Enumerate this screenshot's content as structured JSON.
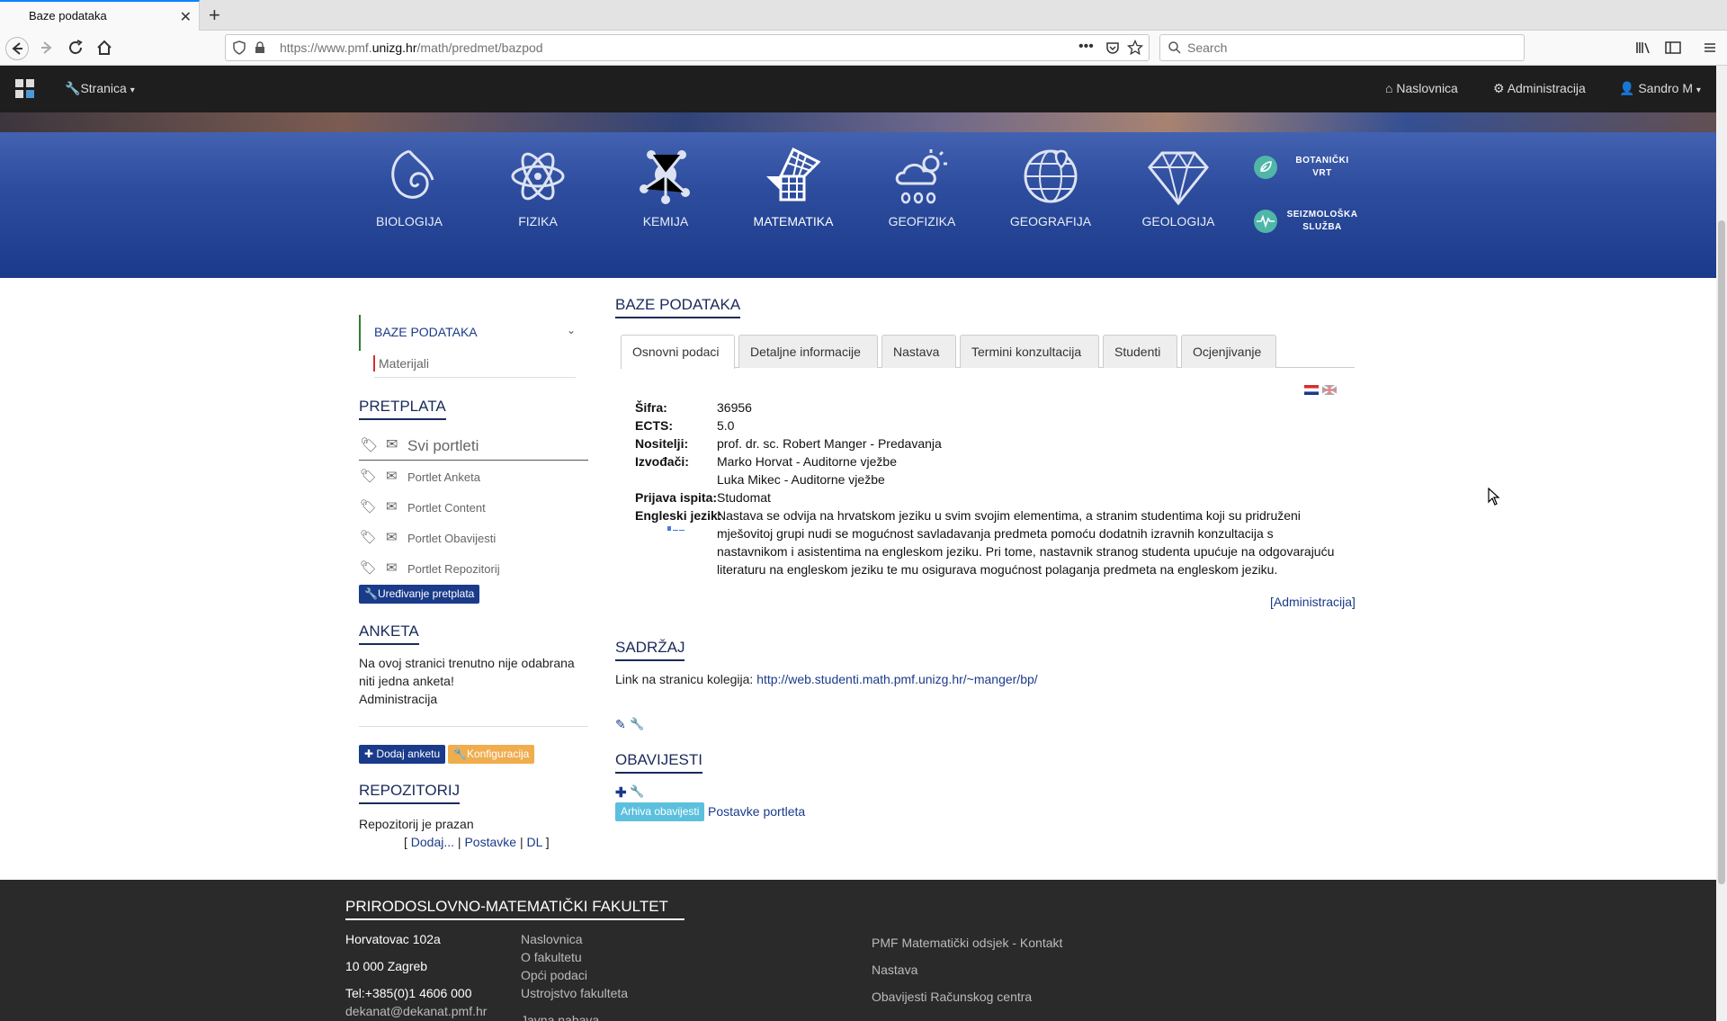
{
  "browser": {
    "tab_title": "Baze podataka",
    "url_prefix": "https://www.pmf.",
    "url_domain": "unizg.hr",
    "url_path": "/math/predmet/bazpod",
    "search_placeholder": "Search"
  },
  "sitebar": {
    "menu_label": "Stranica",
    "home": "Naslovnica",
    "admin": "Administracija",
    "user": "Sandro M"
  },
  "sciences": [
    {
      "label": "BIOLOGIJA"
    },
    {
      "label": "FIZIKA"
    },
    {
      "label": "KEMIJA"
    },
    {
      "label": "MATEMATIKA"
    },
    {
      "label": "GEOFIZIKA"
    },
    {
      "label": "GEOGRAFIJA"
    },
    {
      "label": "GEOLOGIJA"
    }
  ],
  "side_links": {
    "botanicki_1": "BOTANIČKI",
    "botanicki_2": "VRT",
    "seizmo_1": "SEIZMOLOŠKA",
    "seizmo_2": "SLUŽBA"
  },
  "left": {
    "nav_active": "BAZE PODATAKA",
    "nav_sub": "Materijali",
    "pretplata_title": "PRETPLATA",
    "svi_portleti": "Svi portleti",
    "portlets": [
      "Portlet Anketa",
      "Portlet Content",
      "Portlet Obavijesti",
      "Portlet Repozitorij"
    ],
    "uredivanje": "Uređivanje pretplata",
    "anketa_title": "ANKETA",
    "anketa_text_1": "Na ovoj stranici trenutno nije odabrana",
    "anketa_text_2": "niti jedna anketa!",
    "anketa_admin": "Administracija",
    "dodaj_anketu": "Dodaj anketu",
    "konfiguracija": "Konfiguracija",
    "repo_title": "REPOZITORIJ",
    "repo_empty": "Repozitorij je prazan",
    "repo_open": "[",
    "repo_dodaj": "Dodaj...",
    "repo_sep1": "|",
    "repo_postavke": "Postavke",
    "repo_sep2": "|",
    "repo_dl": "DL",
    "repo_close": "]"
  },
  "main": {
    "title": "BAZE PODATAKA",
    "tabs": [
      "Osnovni podaci",
      "Detaljne informacije",
      "Nastava",
      "Termini konzultacija",
      "Studenti",
      "Ocjenjivanje"
    ],
    "info": {
      "sifra_label": "Šifra:",
      "sifra": "36956",
      "ects_label": "ECTS:",
      "ects": "5.0",
      "nositelji_label": "Nositelji:",
      "nositelji": "prof. dr. sc. Robert Manger - Predavanja",
      "izvodaci_label": "Izvođači:",
      "izvodac_1": "Marko Horvat - Auditorne vježbe",
      "izvodac_2": "Luka Mikec - Auditorne vježbe",
      "prijava_label": "Prijava ispita:",
      "prijava": "Studomat",
      "engleski_label": "Engleski jezik:",
      "engleski_1": "Nastava se odvija na hrvatskom jeziku u svim svojim elementima, a stranim studentima koji su pridruženi",
      "engleski_2": "mješovitoj grupi nudi se mogućnost savladavanja predmeta pomoću dodatnih izravnih konzultacija s",
      "engleski_3": "nastavnikom i asistentima na engleskom jeziku. Pri tome, nastavnik stranog studenta upućuje na odgovarajuću",
      "engleski_4": "literaturu na engleskom jeziku te mu osigurava mogućnost polaganja predmeta na engleskom jeziku."
    },
    "admin_link": "[Administracija]",
    "sadrzaj_title": "SADRŽAJ",
    "sadrzaj_text": "Link na stranicu kolegija:",
    "sadrzaj_link": "http://web.studenti.math.pmf.unizg.hr/~manger/bp/",
    "obavijesti_title": "OBAVIJESTI",
    "arhiva": "Arhiva obavijesti",
    "postavke_portleta": "Postavke portleta"
  },
  "footer": {
    "title": "PRIRODOSLOVNO-MATEMATIČKI FAKULTET",
    "addr_1": "Horvatovac 102a",
    "addr_2": "10 000 Zagreb",
    "tel": "Tel:+385(0)1 4606 000",
    "email": "dekanat@dekanat.pmf.hr",
    "links_1": [
      "Naslovnica",
      "O fakultetu",
      "Opći podaci",
      "Ustrojstvo fakulteta",
      "Javna nabava"
    ],
    "links_2": [
      "PMF Matematički odsjek - Kontakt",
      "Nastava",
      "Obavijesti Računskog centra"
    ]
  },
  "colors": {
    "accent_navy": "#1a2b5a",
    "button_navy": "#1a3a8a",
    "button_orange": "#f0ad4e",
    "button_info": "#5bc0de",
    "hero_blue": "#2e4d9e"
  }
}
